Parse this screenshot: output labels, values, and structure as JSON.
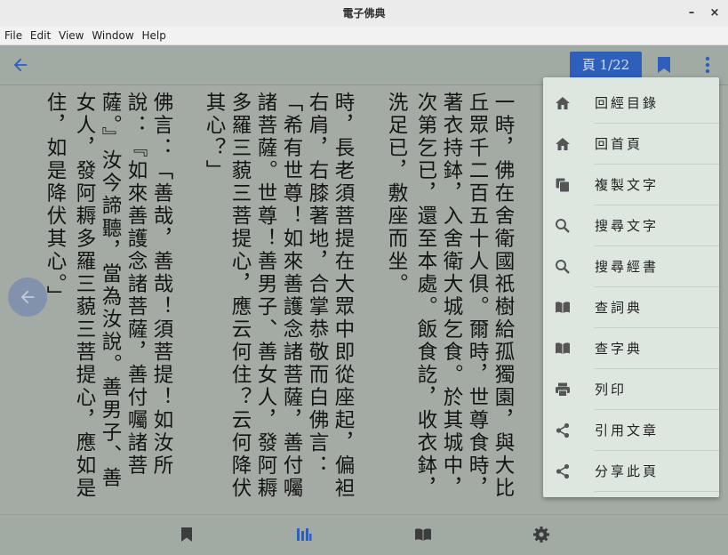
{
  "window": {
    "title": "電子佛典",
    "minimize": "–",
    "close": "×"
  },
  "menubar": [
    "File",
    "Edit",
    "View",
    "Window",
    "Help"
  ],
  "toolbar": {
    "page_label": "頁 1/22"
  },
  "text_columns": [
    "一時，佛在舍衛國祇樹給孤獨園，與大比",
    "丘眾千二百五十人俱。爾時，世尊食時，",
    "著衣持鉢，入舍衛大城乞食。於其城中，",
    "次第乞已，還至本處。飯食訖，收衣鉢，",
    "洗足已，敷座而坐。",
    "時，長老須菩提在大眾中即從座起，偏袒",
    "右肩，右膝著地，合掌恭敬而白佛言：",
    "「希有世尊！如來善護念諸菩薩，善付囑",
    "諸菩薩。世尊！善男子、善女人，發阿耨",
    "多羅三藐三菩提心，應云何住？云何降伏",
    "其心？」",
    "佛言：「善哉，善哉！須菩提！如汝所",
    "說：『如來善護念諸菩薩，善付囑諸菩",
    "薩。』汝今諦聽，當為汝說。善男子、善",
    "女人，發阿耨多羅三藐三菩提心，應如是",
    "住，如是降伏其心。」"
  ],
  "popup_menu": [
    {
      "label": "回經目錄",
      "icon": "home-icon"
    },
    {
      "label": "回首頁",
      "icon": "home-icon"
    },
    {
      "label": "複製文字",
      "icon": "copy-icon"
    },
    {
      "label": "搜尋文字",
      "icon": "search-icon"
    },
    {
      "label": "搜尋經書",
      "icon": "search-icon"
    },
    {
      "label": "查詞典",
      "icon": "book-icon"
    },
    {
      "label": "查字典",
      "icon": "book-icon"
    },
    {
      "label": "列印",
      "icon": "print-icon"
    },
    {
      "label": "引用文章",
      "icon": "share-icon"
    },
    {
      "label": "分享此頁",
      "icon": "share-icon"
    }
  ],
  "bottom_nav": [
    "bookmark-icon",
    "library-icon",
    "book-icon",
    "settings-icon"
  ],
  "colors": {
    "accent": "#2e5fbb",
    "background": "#a4aba4",
    "menu_bg": "#dde7df"
  }
}
